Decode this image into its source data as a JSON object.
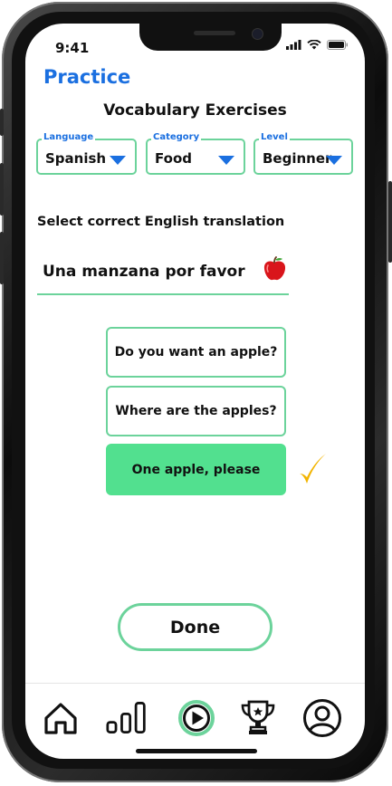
{
  "status_bar": {
    "time": "9:41"
  },
  "header": {
    "title": "Practice"
  },
  "section": {
    "title": "Vocabulary Exercises"
  },
  "filters": {
    "language": {
      "label": "Language",
      "value": "Spanish"
    },
    "category": {
      "label": "Category",
      "value": "Food"
    },
    "level": {
      "label": "Level",
      "value": "Beginner"
    }
  },
  "exercise": {
    "instruction": "Select correct English translation",
    "phrase": "Una manzana por favor",
    "phrase_icon": "apple-icon",
    "options": [
      {
        "label": "Do you want an apple?",
        "selected": false
      },
      {
        "label": "Where are the apples?",
        "selected": false
      },
      {
        "label": "One apple, please",
        "selected": true
      }
    ],
    "result_icon": "checkmark-icon"
  },
  "actions": {
    "done_label": "Done"
  },
  "tabbar": {
    "items": [
      {
        "icon": "home-icon"
      },
      {
        "icon": "stats-icon"
      },
      {
        "icon": "play-icon",
        "active": true
      },
      {
        "icon": "trophy-icon"
      },
      {
        "icon": "profile-icon"
      }
    ]
  },
  "colors": {
    "accent": "#1a6fe0",
    "green": "#6cd39b",
    "selected": "#52e08f",
    "check": "#f2b400"
  }
}
